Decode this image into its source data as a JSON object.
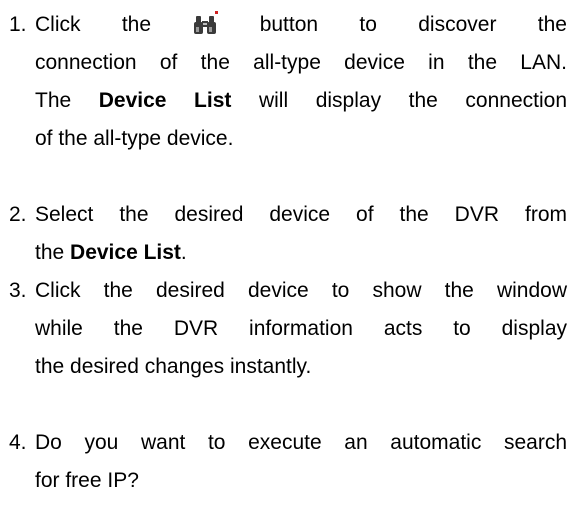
{
  "steps": [
    {
      "number": "1.",
      "words_before_icon": [
        "Click",
        "the"
      ],
      "icon": "binoculars-icon",
      "words_after_icon": [
        "button",
        "to",
        "discover",
        "the"
      ],
      "line2": "connection of the all-type device in the LAN.",
      "line3_pre": "The ",
      "line3_bold": "Device List",
      "line3_post": " will display the connection",
      "line4": "of the all-type device."
    },
    {
      "number": "2.",
      "line1": "Select the desired device of the DVR from",
      "line2_pre": "the ",
      "line2_bold": "Device List",
      "line2_post": "."
    },
    {
      "number": "3.",
      "line1": "Click the desired device to show the window",
      "line2": "while the DVR information acts to display",
      "line3": "the desired changes instantly."
    },
    {
      "number": "4.",
      "line1": "Do you want to execute an automatic search",
      "line2": "for free IP?"
    }
  ],
  "colors": {
    "text": "#000000",
    "background": "#ffffff",
    "icon_dark": "#3a3a3a",
    "icon_mark": "#d02020"
  }
}
